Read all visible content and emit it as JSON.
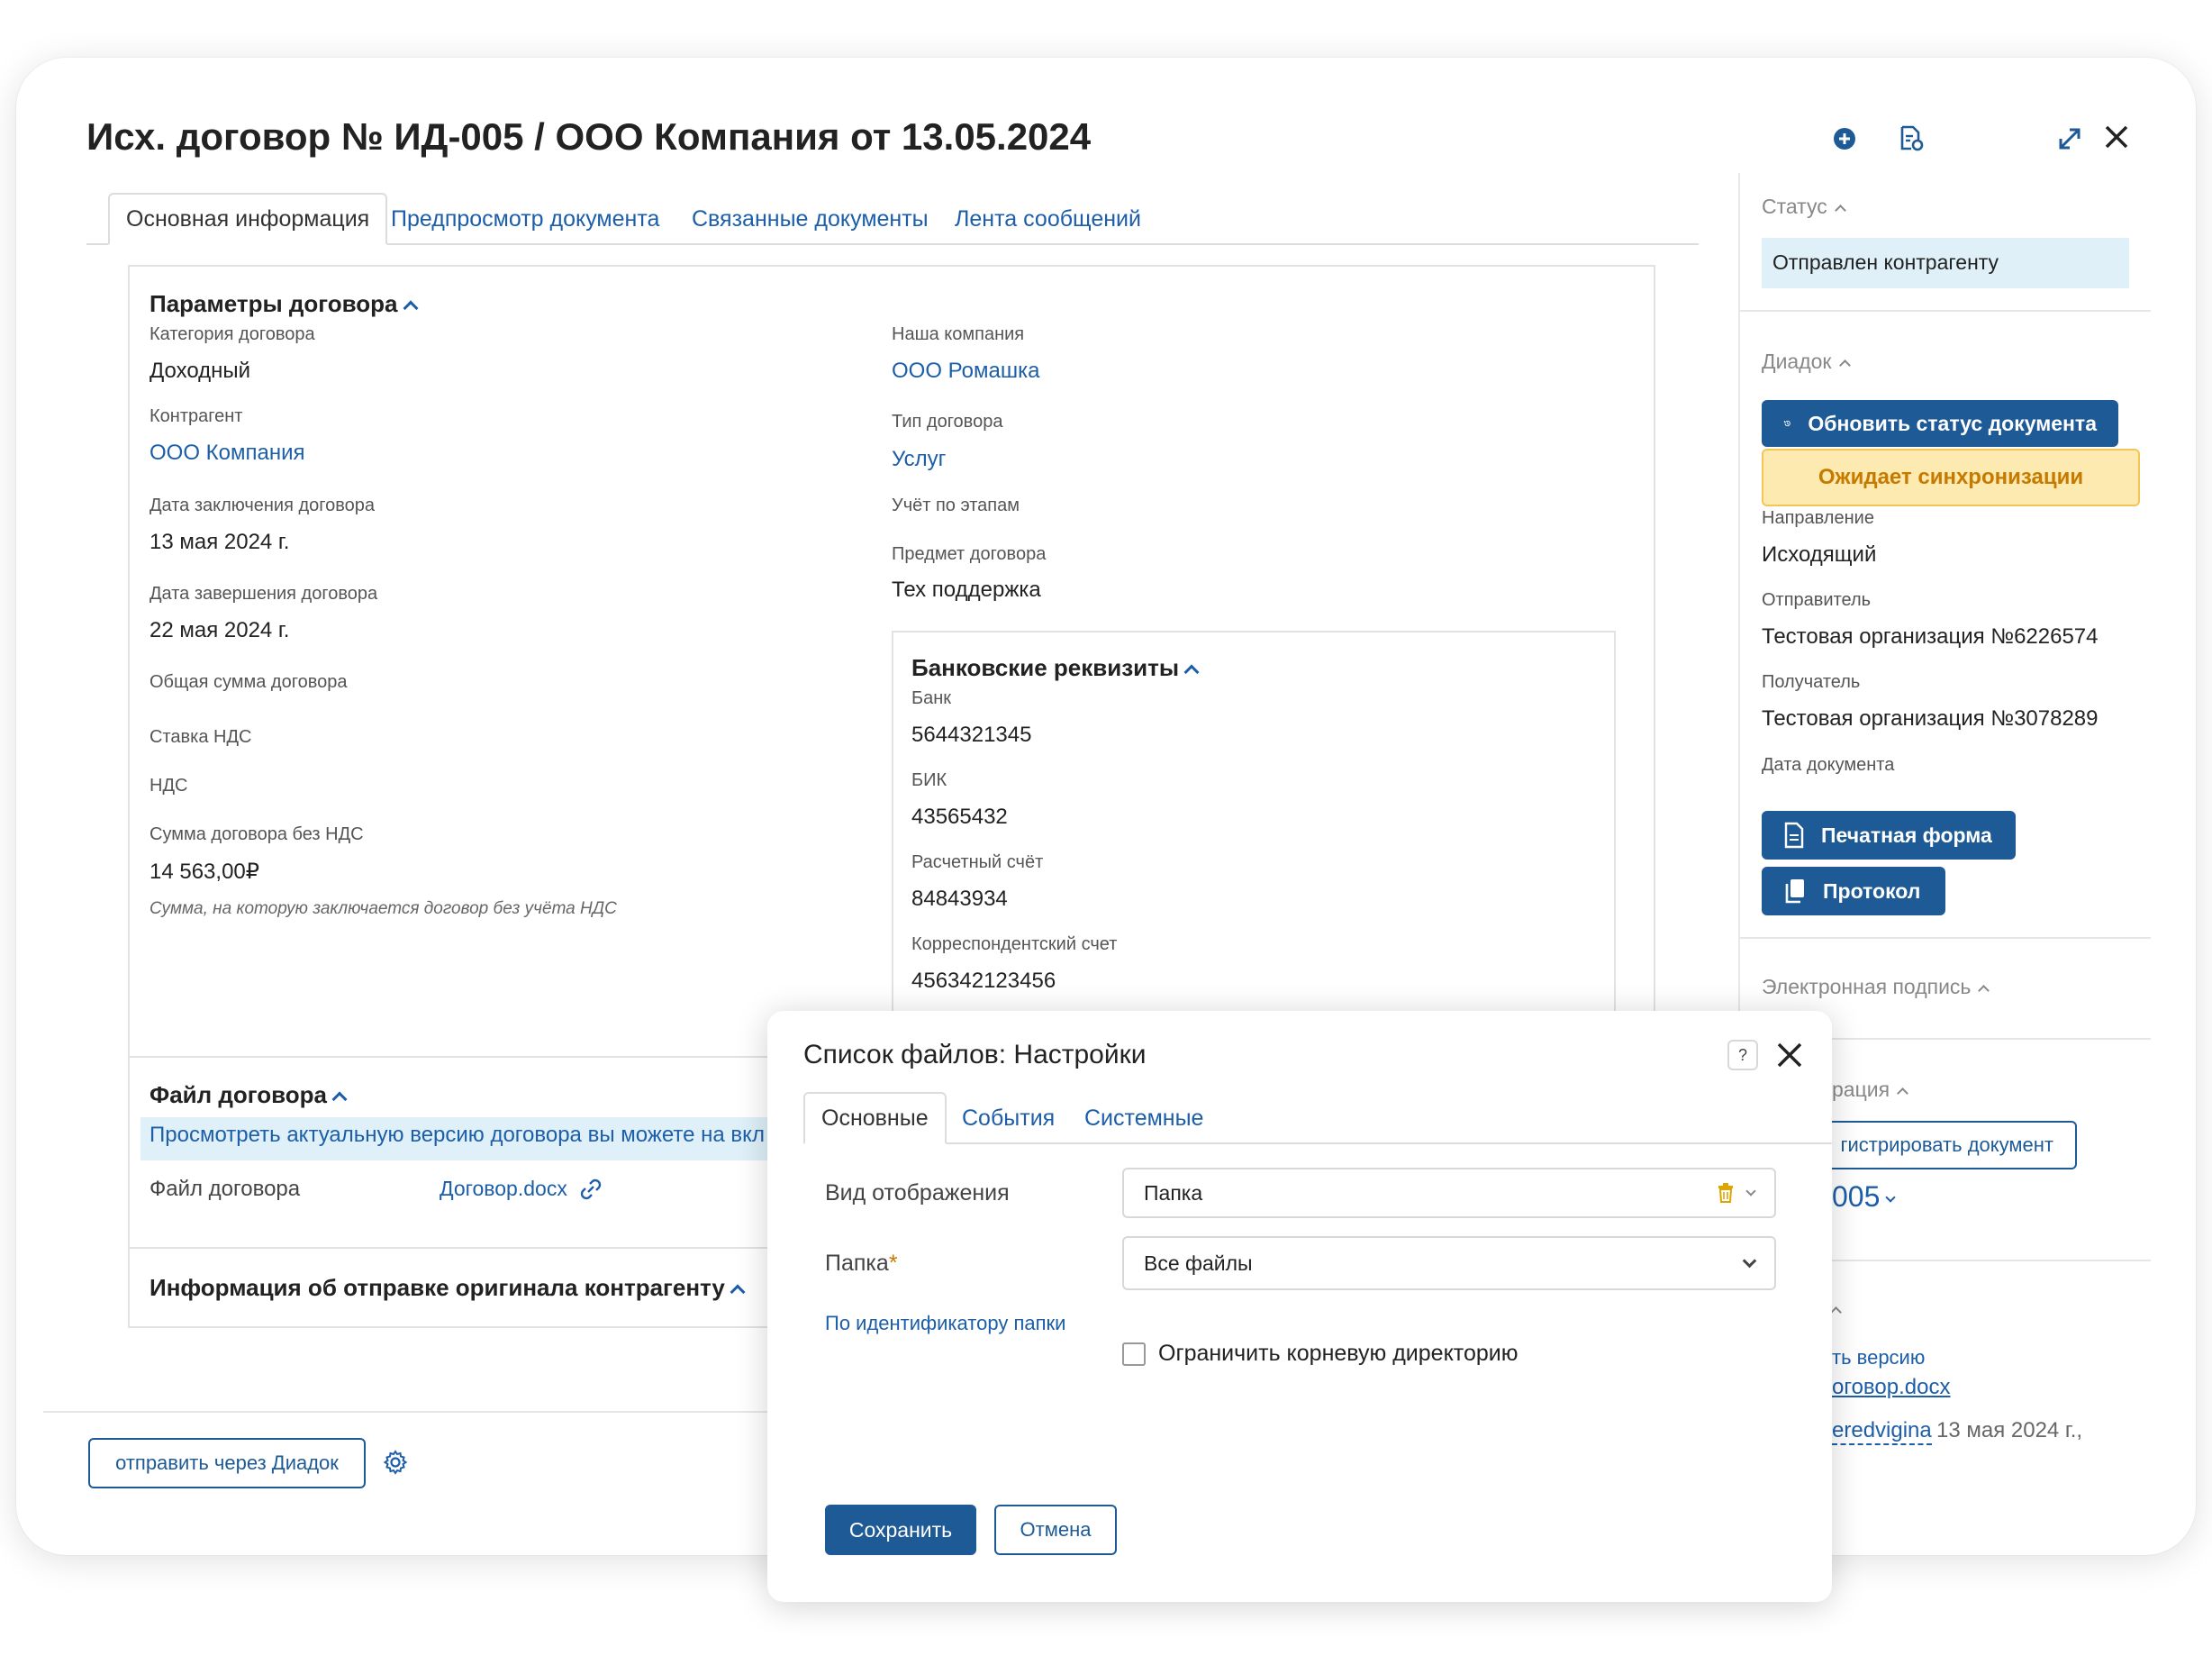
{
  "header": {
    "title": "Исх. договор № ИД-005 / ООО Компания от 13.05.2024",
    "icons": [
      "plus-circle-icon",
      "document-settings-icon",
      "expand-icon",
      "close-icon"
    ]
  },
  "tabs": [
    {
      "label": "Основная информация",
      "active": true
    },
    {
      "label": "Предпросмотр документа",
      "active": false
    },
    {
      "label": "Связанные документы",
      "active": false
    },
    {
      "label": "Лента сообщений",
      "active": false
    }
  ],
  "contract_params": {
    "title": "Параметры договора",
    "left": [
      {
        "label": "Категория договора",
        "value": "Доходный",
        "link": false
      },
      {
        "label": "Контрагент",
        "value": "ООО Компания",
        "link": true
      },
      {
        "label": "Дата заключения договора",
        "value": "13 мая 2024 г.",
        "link": false
      },
      {
        "label": "Дата завершения договора",
        "value": "22 мая 2024 г.",
        "link": false
      },
      {
        "label": "Общая сумма договора",
        "value": "",
        "link": false
      },
      {
        "label": "Ставка НДС",
        "value": "",
        "link": false
      },
      {
        "label": "НДС",
        "value": "",
        "link": false
      },
      {
        "label": "Сумма договора без НДС",
        "value": "14 563,00₽",
        "link": false
      }
    ],
    "hint": "Сумма, на которую заключается договор без учёта НДС",
    "right": [
      {
        "label": "Наша компания",
        "value": "ООО Ромашка",
        "link": true
      },
      {
        "label": "Тип договора",
        "value": "Услуг",
        "link": true
      },
      {
        "label": "Учёт по этапам",
        "value": "",
        "link": false
      },
      {
        "label": "Предмет договора",
        "value": "Тех поддержка",
        "link": false
      }
    ]
  },
  "bank": {
    "title": "Банковские реквизиты",
    "fields": [
      {
        "label": "Банк",
        "value": "5644321345"
      },
      {
        "label": "БИК",
        "value": "43565432"
      },
      {
        "label": "Расчетный счёт",
        "value": "84843934"
      },
      {
        "label": "Корреспондентский счет",
        "value": "456342123456"
      }
    ]
  },
  "contract_file": {
    "title": "Файл договора",
    "banner": "Просмотреть актуальную версию договора вы можете на вкл",
    "file_label": "Файл договора",
    "file_name": "Договор.docx"
  },
  "original_info": {
    "title": "Информация об отправке оригинала контрагенту"
  },
  "footer": {
    "send_button": "отправить через Диадок"
  },
  "sidebar": {
    "status": {
      "title": "Статус",
      "value": "Отправлен контрагенту"
    },
    "diadoc": {
      "title": "Диадок",
      "update_button": "Обновить статус документа",
      "sync_badge": "Ожидает синхронизации",
      "fields": [
        {
          "label": "Направление",
          "value": "Исходящий"
        },
        {
          "label": "Отправитель",
          "value": "Тестовая организация №6226574"
        },
        {
          "label": "Получатель",
          "value": "Тестовая организация №3078289"
        },
        {
          "label": "Дата документа",
          "value": ""
        }
      ],
      "print_button": "Печатная форма",
      "protocol_button": "Протокол"
    },
    "esign": {
      "title": "Электронная подпись"
    },
    "registration": {
      "title_fragment": "рация",
      "button_fragment": "гистрировать документ",
      "number_fragment": "005"
    },
    "versions": {
      "title_fragment": "",
      "line1": "ть версию",
      "file_fragment": "оговор.docx",
      "user_fragment": "eredvigina",
      "date": "13 мая 2024 г.,"
    }
  },
  "modal": {
    "title": "Список файлов: Настройки",
    "tabs": [
      {
        "label": "Основные",
        "active": true
      },
      {
        "label": "События",
        "active": false
      },
      {
        "label": "Системные",
        "active": false
      }
    ],
    "view_label": "Вид отображения",
    "view_value": "Папка",
    "folder_label": "Папка",
    "required_mark": "*",
    "folder_value": "Все файлы",
    "by_id_link": "По идентификатору папки",
    "limit_root_label": "Ограничить корневую директорию",
    "limit_root_checked": false,
    "save_button": "Сохранить",
    "cancel_button": "Отмена"
  },
  "colors": {
    "primary": "#1e5a96",
    "link": "#1c5ea8",
    "status_bg": "#dff0f8",
    "sync_bg": "#fdeab0",
    "sync_text": "#c67a00",
    "trash": "#e0a400"
  }
}
